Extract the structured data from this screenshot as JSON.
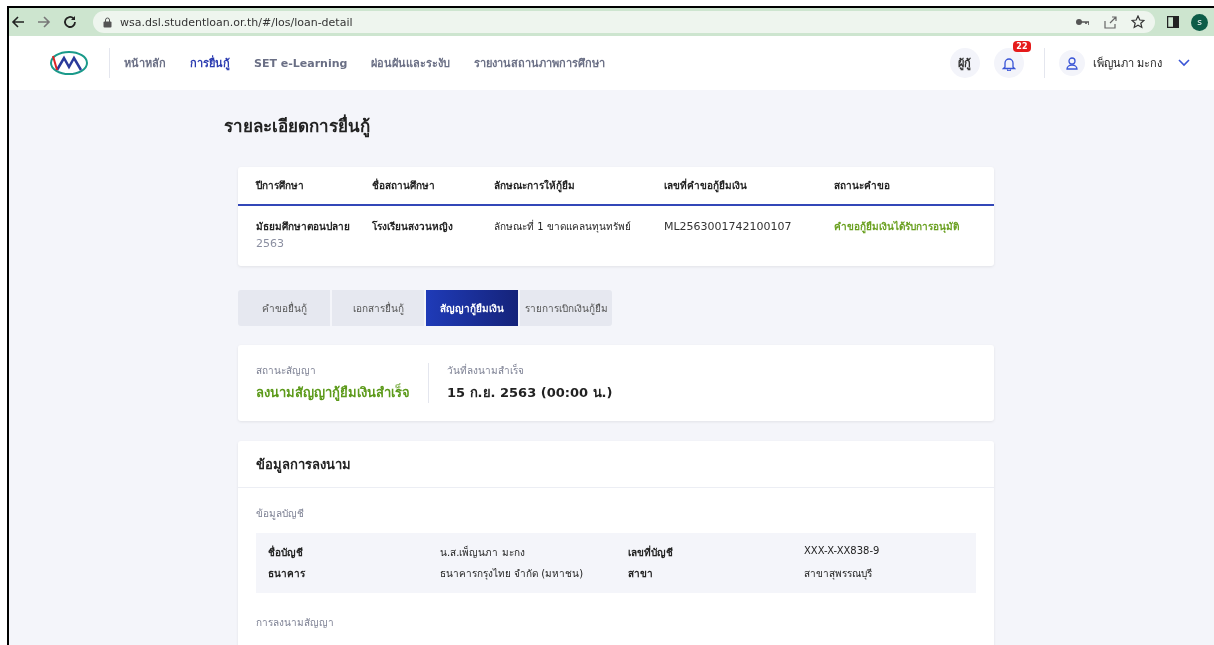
{
  "browser": {
    "url": "wsa.dsl.studentloan.or.th/#/los/loan-detail",
    "profile_initial": "s"
  },
  "nav": {
    "items": [
      {
        "label": "หน้าหลัก",
        "selected": false
      },
      {
        "label": "การยื่นกู้",
        "selected": true
      },
      {
        "label": "SET e-Learning",
        "selected": false
      },
      {
        "label": "ผ่อนผันและระงับ",
        "selected": false
      },
      {
        "label": "รายงานสถานภาพการศึกษา",
        "selected": false
      }
    ],
    "role": "ผู้กู้",
    "notification_count": "22",
    "user_name": "เพ็ญนภา มะกง"
  },
  "page_title": "รายละเอียดการยื่นกู้",
  "summary": {
    "columns": [
      "ปีการศึกษา",
      "ชื่อสถานศึกษา",
      "ลักษณะการให้กู้ยืม",
      "เลขที่คำขอกู้ยืมเงิน",
      "สถานะคำขอ"
    ],
    "level": "มัธยมศึกษาตอนปลาย",
    "year": "2563",
    "school": "โรงเรียนสงวนหญิง",
    "loan_type": "ลักษณะที่ 1 ขาดแคลนทุนทรัพย์",
    "request_no": "ML2563001742100107",
    "status": "คำขอกู้ยืมเงินได้รับการอนุมัติ"
  },
  "tabs": [
    {
      "label": "คำขอยื่นกู้",
      "selected": false
    },
    {
      "label": "เอกสารยื่นกู้",
      "selected": false
    },
    {
      "label": "สัญญากู้ยืมเงิน",
      "selected": true
    },
    {
      "label": "รายการเบิกเงินกู้ยืม",
      "selected": false
    }
  ],
  "contract_status": {
    "status_label": "สถานะสัญญา",
    "status": "ลงนามสัญญากู้ยืมเงินสำเร็จ",
    "date_label": "วันที่ลงนามสำเร็จ",
    "date": "15 ก.ย. 2563 (00:00 น.)"
  },
  "signing": {
    "title": "ข้อมูลการลงนาม",
    "account_heading": "ข้อมูลบัญชี",
    "account_rows": [
      {
        "label": "ชื่อบัญชี",
        "value": "น.ส.เพ็ญนภา มะกง",
        "label_2": "เลขที่บัญชี",
        "value_2": "XXX-X-XX838-9"
      },
      {
        "label": "ธนาคาร",
        "value": "ธนาคารกรุงไทย จำกัด (มหาชน)",
        "label_2": "สาขา",
        "value_2": "สาขาสุพรรณบุรี"
      }
    ],
    "contract_heading": "การลงนามสัญญา"
  }
}
